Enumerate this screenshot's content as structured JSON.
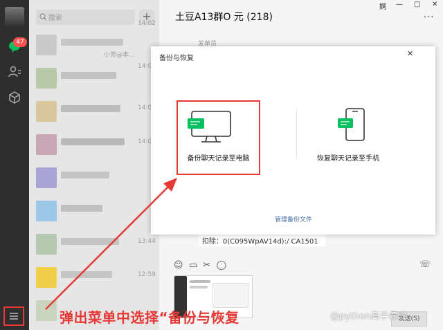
{
  "window": {
    "controls": [
      "婀",
      "—",
      "□",
      "✕"
    ]
  },
  "rail": {
    "unread_badge": "47"
  },
  "list": {
    "search_placeholder": "搜索",
    "plus": "+",
    "times": [
      "14:02",
      "14:01",
      "14:01",
      "14:00",
      "13:44",
      "12:59"
    ],
    "snippet_1": "小芳@本..."
  },
  "chat": {
    "title": "土豆A13群O 元 (218)",
    "more": "···",
    "sender": "发单员",
    "message": "扣除：0(C095WpAV14d):/ CA1501",
    "send_label": "发送(S)"
  },
  "dialog": {
    "title": "备份与恢复",
    "close": "✕",
    "backup_label": "备份聊天记录至电脑",
    "restore_label": "恢复聊天记录至手机",
    "manage_label": "管理备份文件"
  },
  "annotation": {
    "text": "弹出菜单中选择“备份与恢复",
    "color": "#e53935"
  },
  "watermark": "@python高手养成",
  "colors": {
    "rail": "#2e2e2e",
    "list": "#e6e6e6",
    "accent_green": "#07c160",
    "badge": "#fa5151"
  }
}
